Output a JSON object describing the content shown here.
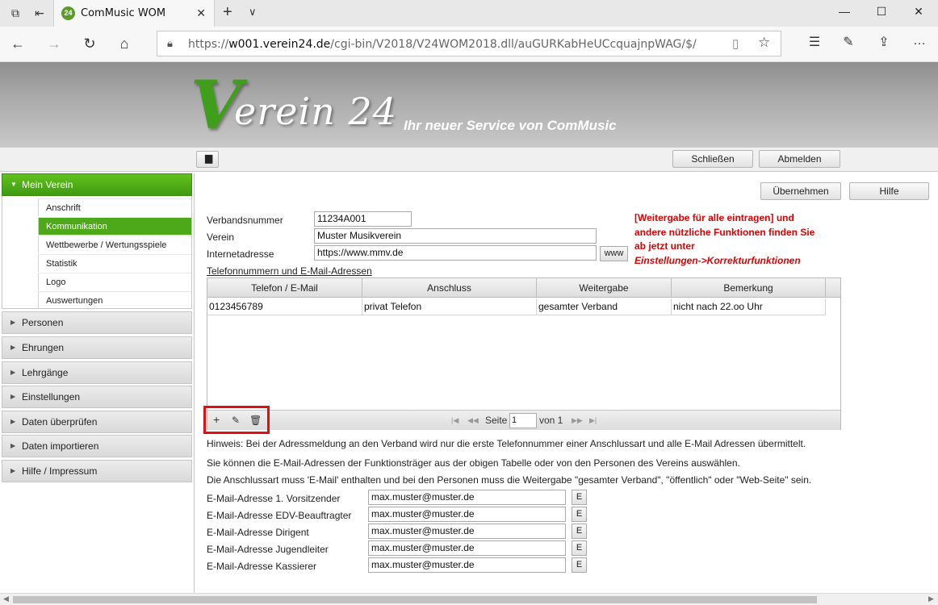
{
  "browser": {
    "tab_title": "ComMusic WOM",
    "tab_favicon": "24",
    "url_prefix": "https://",
    "url_host": "w001.verein24.de",
    "url_path": "/cgi-bin/V2018/V24WOM2018.dll/auGURKabHeUCcquajnpWAG/$/"
  },
  "header": {
    "logo_v": "V",
    "logo_rest": "erein 24",
    "slogan": "Ihr neuer Service von ComMusic"
  },
  "toolbar": {
    "close_label": "Schließen",
    "logout_label": "Abmelden"
  },
  "sidebar": {
    "groups": [
      {
        "label": "Mein Verein"
      },
      {
        "label": "Personen"
      },
      {
        "label": "Ehrungen"
      },
      {
        "label": "Lehrgänge"
      },
      {
        "label": "Einstellungen"
      },
      {
        "label": "Daten überprüfen"
      },
      {
        "label": "Daten importieren"
      },
      {
        "label": "Hilfe / Impressum"
      }
    ],
    "sub_items": [
      {
        "label": "Anschrift"
      },
      {
        "label": "Kommunikation"
      },
      {
        "label": "Wettbewerbe / Wertungsspiele"
      },
      {
        "label": "Statistik"
      },
      {
        "label": "Logo"
      },
      {
        "label": "Auswertungen"
      }
    ]
  },
  "main": {
    "apply_label": "Übernehmen",
    "help_label": "Hilfe",
    "verbandsnummer_label": "Verbandsnummer",
    "verbandsnummer_value": "11234A001",
    "verein_label": "Verein",
    "verein_value": "Muster Musikverein",
    "internet_label": "Internetadresse",
    "internet_value": "https://www.mmv.de",
    "www_label": "www",
    "section_title": "Telefonnummern und E-Mail-Adressen",
    "notice_line1": "[Weitergabe für alle eintragen] und",
    "notice_line2": "andere nützliche Funktionen finden Sie",
    "notice_line3": "ab jetzt unter",
    "notice_line4": "Einstellungen->Korrekturfunktionen",
    "table": {
      "columns": [
        "Telefon / E-Mail",
        "Anschluss",
        "Weitergabe",
        "Bemerkung"
      ],
      "rows": [
        [
          "0123456789",
          "privat Telefon",
          "gesamter Verband",
          "nicht nach 22.oo Uhr"
        ]
      ]
    },
    "pager": {
      "page_label": "Seite",
      "page_value": "1",
      "of_label": "von 1"
    },
    "hint1": "Hinweis: Bei der Adressmeldung an den Verband wird nur die erste Telefonnummer einer Anschlussart und alle E-Mail Adressen übermittelt.",
    "hint2": "Sie können die E-Mail-Adressen der Funktionsträger aus der obigen Tabelle oder von den Personen des Vereins auswählen.",
    "hint3": "Die Anschlussart muss 'E-Mail' enthalten und bei den Personen muss die Weitergabe \"gesamter Verband\", \"öffentlich\" oder \"Web-Seite\" sein.",
    "emails": [
      {
        "label": "E-Mail-Adresse 1. Vorsitzender",
        "value": "max.muster@muster.de",
        "btn": "E"
      },
      {
        "label": "E-Mail-Adresse EDV-Beauftragter",
        "value": "max.muster@muster.de",
        "btn": "E"
      },
      {
        "label": "E-Mail-Adresse Dirigent",
        "value": "max.muster@muster.de",
        "btn": "E"
      },
      {
        "label": "E-Mail-Adresse Jugendleiter",
        "value": "max.muster@muster.de",
        "btn": "E"
      },
      {
        "label": "E-Mail-Adresse Kassierer",
        "value": "max.muster@muster.de",
        "btn": "E"
      }
    ]
  },
  "colors": {
    "accent_green": "#4da81a",
    "notice_red": "#e00000",
    "highlight_red": "#e01010"
  }
}
